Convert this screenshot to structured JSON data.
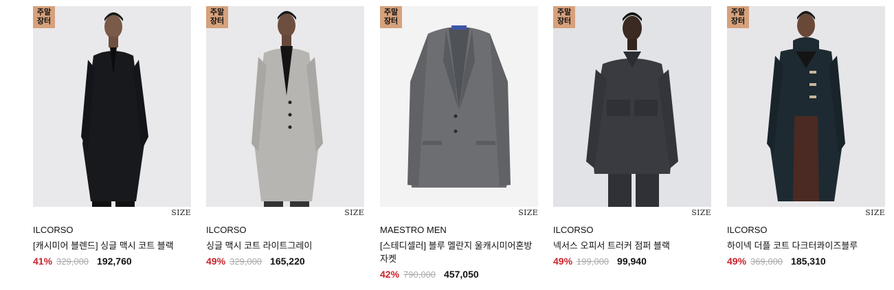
{
  "products": [
    {
      "badge_line1": "주말",
      "badge_line2": "장터",
      "size_label": "SIZE",
      "brand": "ILCORSO",
      "name": "[캐시미어 블렌드] 싱글 맥시 코트 블랙",
      "discount": "41%",
      "original_price": "329,000",
      "sale_price": "192,760",
      "image": "black single maxi coat on model"
    },
    {
      "badge_line1": "주말",
      "badge_line2": "장터",
      "size_label": "SIZE",
      "brand": "ILCORSO",
      "name": "싱글 맥시 코트 라이트그레이",
      "discount": "49%",
      "original_price": "329,000",
      "sale_price": "165,220",
      "image": "light grey single maxi coat on model"
    },
    {
      "badge_line1": "주말",
      "badge_line2": "장터",
      "size_label": "SIZE",
      "brand": "MAESTRO MEN",
      "name": "[스테디셀러] 블루 멜란지 울캐시미어혼방 자켓",
      "discount": "42%",
      "original_price": "790,000",
      "sale_price": "457,050",
      "image": "blue melange blazer"
    },
    {
      "badge_line1": "주말",
      "badge_line2": "장터",
      "size_label": "SIZE",
      "brand": "ILCORSO",
      "name": "넥서스 오피서 트러커 점퍼 블랙",
      "discount": "49%",
      "original_price": "199,000",
      "sale_price": "99,940",
      "image": "black trucker jacket on model"
    },
    {
      "badge_line1": "주말",
      "badge_line2": "장터",
      "size_label": "SIZE",
      "brand": "ILCORSO",
      "name": "하이넥 더플 코트 다크터콰이즈블루",
      "discount": "49%",
      "original_price": "369,000",
      "sale_price": "185,310",
      "image": "dark turquoise duffle coat on model"
    }
  ]
}
